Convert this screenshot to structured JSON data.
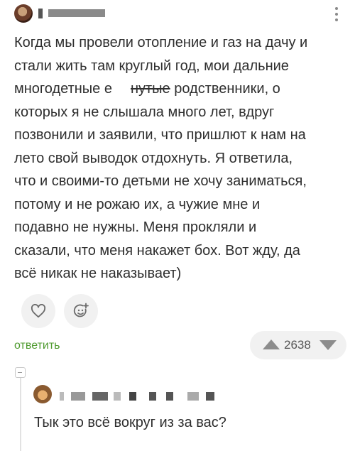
{
  "comment": {
    "lines": [
      "Когда мы провели отопление и газ на дачу и",
      "стали жить там круглый год, мои дальние",
      "многодетные е",
      "нутые",
      " родственники, о",
      "которых я не слышала много лет, вдруг",
      "позвонили и заявили, что пришлют к нам на",
      "лето свой выводок отдохнуть. Я ответила,",
      "что и своими-то детьми не хочу заниматься,",
      "потому и не рожаю их, а чужие мне и",
      "подавно не нужны. Меня прокляли и",
      "сказали, что меня накажет бох. Вот жду, да",
      "всё никак не наказывает)"
    ]
  },
  "actions": {
    "like_icon": "heart-outline-icon",
    "react_icon": "smiley-plus-icon",
    "reply_label": "ответить"
  },
  "rating": {
    "score": "2638",
    "up_icon": "triangle-up-icon",
    "down_icon": "triangle-down-icon"
  },
  "reply": {
    "text": "Тык это всё вокруг из за вас?"
  },
  "colors": {
    "accent_green": "#4e9a2e",
    "button_bg": "#f1f1f1",
    "text": "#2e2e2e"
  }
}
